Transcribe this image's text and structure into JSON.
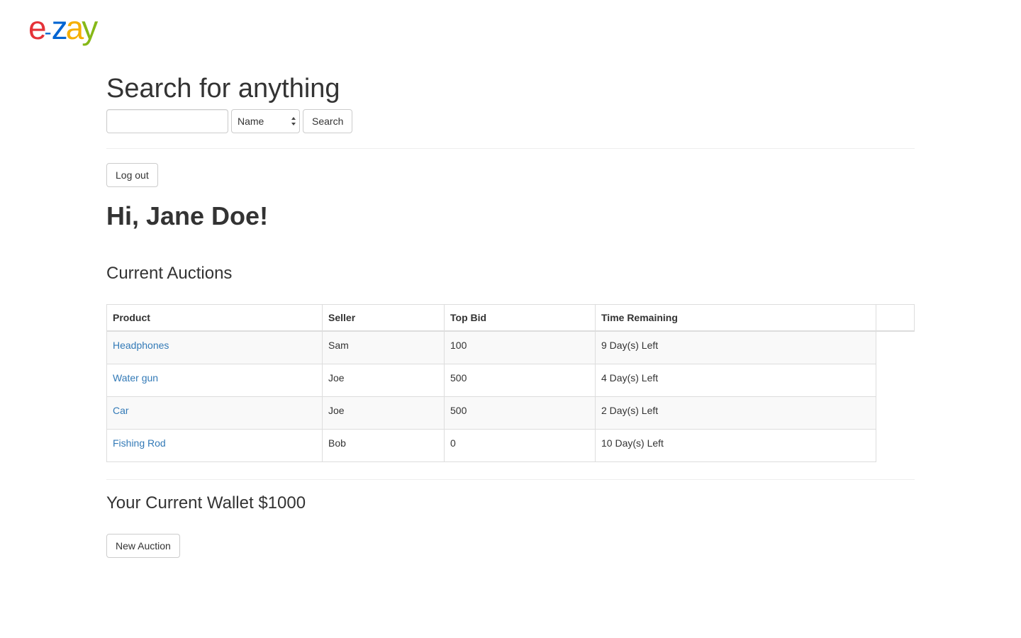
{
  "logo": {
    "letters": [
      {
        "char": "e",
        "color": "#e53238"
      },
      {
        "char": "-",
        "color": "#0064d2"
      },
      {
        "char": "z",
        "color": "#0064d2"
      },
      {
        "char": "a",
        "color": "#f5af02"
      },
      {
        "char": "y",
        "color": "#86b817"
      }
    ]
  },
  "search": {
    "title": "Search for anything",
    "input_value": "",
    "select_value": "Name",
    "button_label": "Search"
  },
  "logout_label": "Log out",
  "greeting": "Hi, Jane Doe!",
  "auctions": {
    "title": "Current Auctions",
    "columns": [
      "Product",
      "Seller",
      "Top Bid",
      "Time Remaining",
      ""
    ],
    "rows": [
      {
        "product": "Headphones",
        "seller": "Sam",
        "top_bid": "100",
        "time": "9 Day(s) Left"
      },
      {
        "product": "Water gun",
        "seller": "Joe",
        "top_bid": "500",
        "time": "4 Day(s) Left"
      },
      {
        "product": "Car",
        "seller": "Joe",
        "top_bid": "500",
        "time": "2 Day(s) Left"
      },
      {
        "product": "Fishing Rod",
        "seller": "Bob",
        "top_bid": "0",
        "time": "10 Day(s) Left"
      }
    ]
  },
  "wallet": "Your Current Wallet $1000",
  "new_auction_label": "New Auction",
  "colors": {
    "link": "#337ab7",
    "border": "#dddddd",
    "stripe": "#f9f9f9"
  }
}
